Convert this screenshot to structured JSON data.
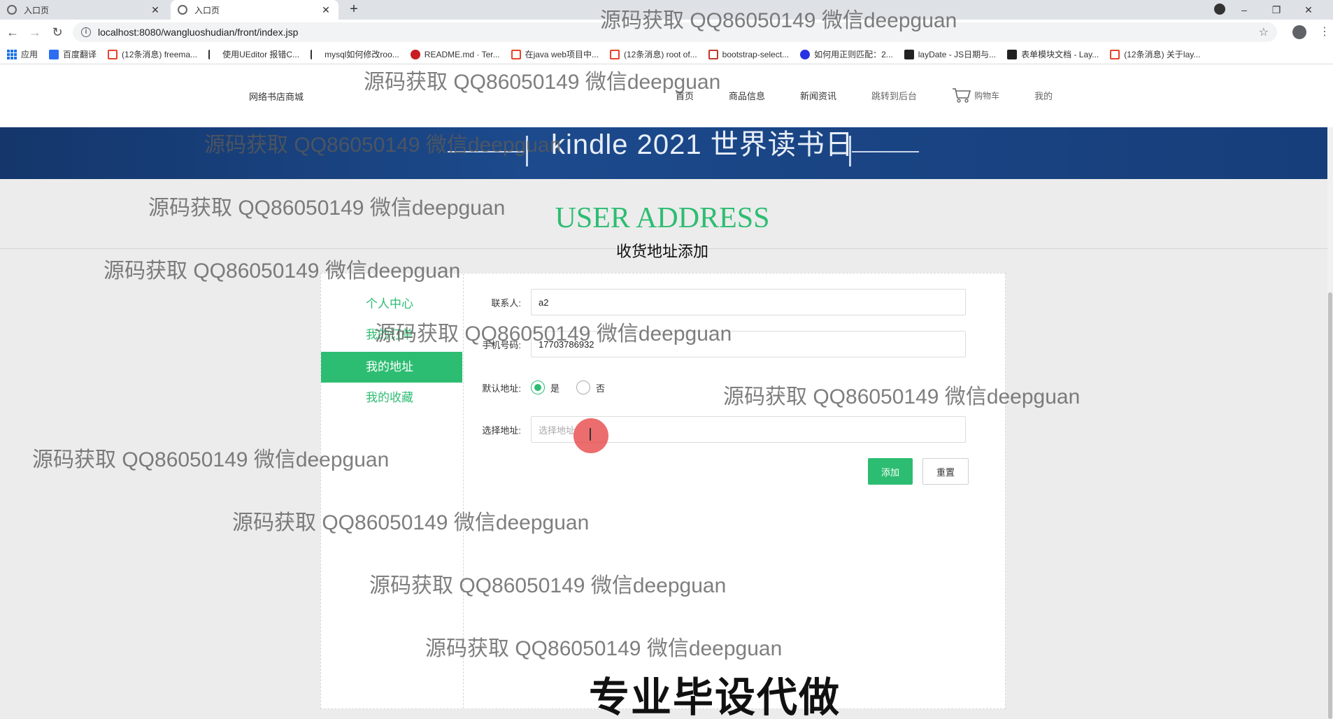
{
  "browser": {
    "tabs": [
      {
        "label": "入口页",
        "active": false
      },
      {
        "label": "入口页",
        "active": true
      }
    ],
    "new_tab": "+",
    "url": "localhost:8080/wangluoshudian/front/index.jsp",
    "bookmarks": [
      {
        "label": "应用",
        "icon": "apps-icon",
        "color": "#1a73e8"
      },
      {
        "label": "百度翻译",
        "icon": "translate-icon",
        "color": "#2b6ef2"
      },
      {
        "label": "(12条消息) freema...",
        "icon": "csdn-icon",
        "color": "#e5442c"
      },
      {
        "label": "使用UEditor 报错C...",
        "icon": "bird-icon",
        "color": "#333333"
      },
      {
        "label": "mysql如何修改roo...",
        "icon": "bird-icon",
        "color": "#333333"
      },
      {
        "label": "README.md · Ter...",
        "icon": "gitee-icon",
        "color": "#c71d23"
      },
      {
        "label": "在java web项目中...",
        "icon": "csdn-icon",
        "color": "#e5442c"
      },
      {
        "label": "(12条消息) root of...",
        "icon": "csdn-icon",
        "color": "#e5442c"
      },
      {
        "label": "bootstrap-select...",
        "icon": "grid-icon",
        "color": "#c0392b"
      },
      {
        "label": "如何用正则匹配：2...",
        "icon": "baidu-icon",
        "color": "#2932e1"
      },
      {
        "label": "layDate - JS日期与...",
        "icon": "layui-icon",
        "color": "#222222"
      },
      {
        "label": "表单模块文档 - Lay...",
        "icon": "layui-icon",
        "color": "#222222"
      },
      {
        "label": "(12条消息) 关于lay...",
        "icon": "csdn-icon",
        "color": "#e5442c"
      }
    ]
  },
  "site": {
    "title": "网络书店商城",
    "nav": [
      "首页",
      "商品信息",
      "新闻资讯",
      "跳转到后台"
    ],
    "cart": "购物车",
    "mine": "我的",
    "banner_text": "kindle 2021 世界读书日"
  },
  "page": {
    "heading_en": "USER ADDRESS",
    "heading_cn": "收货地址添加",
    "sidebar": [
      "个人中心",
      "我的订单",
      "我的地址",
      "我的收藏"
    ],
    "sidebar_active_index": 2,
    "form": {
      "contact_label": "联系人:",
      "contact_value": "a2",
      "phone_label": "手机号码:",
      "phone_value": "17703786932",
      "default_label": "默认地址:",
      "default_yes": "是",
      "default_no": "否",
      "default_selected": "是",
      "address_label": "选择地址:",
      "address_placeholder": "选择地址",
      "submit": "添加",
      "reset": "重置"
    }
  },
  "overlay": {
    "watermark": "源码获取 QQ86050149 微信deepguan",
    "stamp": "专业毕设代做"
  },
  "colors": {
    "accent": "#2dbd72",
    "banner": "#1c4a8c"
  }
}
